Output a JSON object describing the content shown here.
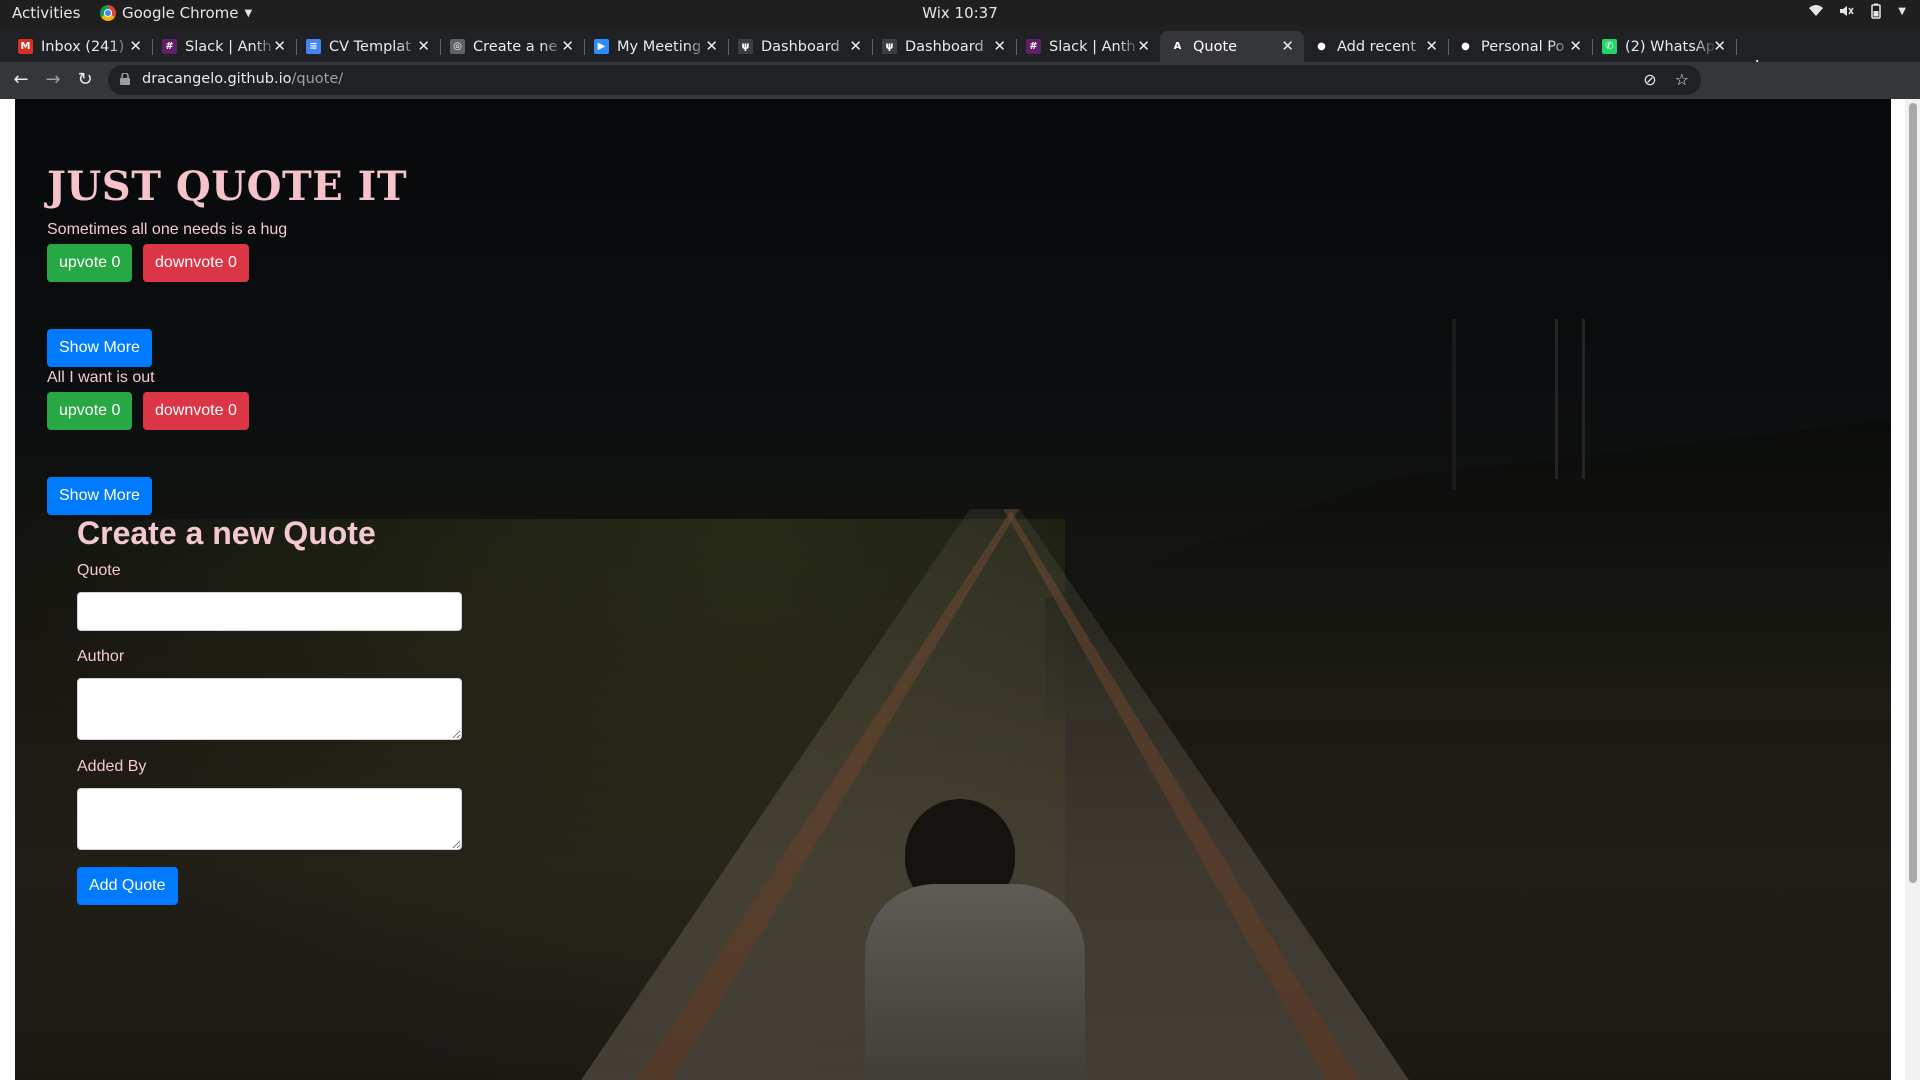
{
  "os_bar": {
    "activities": "Activities",
    "app_name": "Google Chrome",
    "clock": "Wix 10:37"
  },
  "browser": {
    "tabs": [
      {
        "title": "Inbox (241)",
        "icon": "gmail-icon",
        "color": "#d93025",
        "active": false
      },
      {
        "title": "Slack | Anth",
        "icon": "slack-icon",
        "color": "#611f69",
        "active": false
      },
      {
        "title": "CV Templat",
        "icon": "docs-icon",
        "color": "#4285f4",
        "active": false
      },
      {
        "title": "Create a ne",
        "icon": "globe-icon",
        "color": "#5f6368",
        "active": false
      },
      {
        "title": "My Meeting",
        "icon": "zoom-icon",
        "color": "#2d8cff",
        "active": false
      },
      {
        "title": "Dashboard",
        "icon": "palm-icon",
        "color": "#3c4043",
        "active": false
      },
      {
        "title": "Dashboard",
        "icon": "palm-icon",
        "color": "#3c4043",
        "active": false
      },
      {
        "title": "Slack | Anth",
        "icon": "slack-icon",
        "color": "#611f69",
        "active": false
      },
      {
        "title": "Quote",
        "icon": "angular-a-icon",
        "color": "#35363a",
        "active": true
      },
      {
        "title": "Add recent",
        "icon": "github-icon",
        "color": "#202124",
        "active": false
      },
      {
        "title": "Personal Po",
        "icon": "github-icon",
        "color": "#202124",
        "active": false
      },
      {
        "title": "(2) WhatsAp",
        "icon": "whatsapp-icon",
        "color": "#25d366",
        "active": false
      }
    ],
    "url_host": "dracangelo.github.io",
    "url_path": "/quote/"
  },
  "page": {
    "title": "JUST QUOTE IT",
    "quotes": [
      {
        "text": "Sometimes all one needs is a hug",
        "upvote_label": "upvote 0",
        "downvote_label": "downvote 0",
        "show_more_label": "Show More"
      },
      {
        "text": "All I want is out",
        "upvote_label": "upvote 0",
        "downvote_label": "downvote 0",
        "show_more_label": "Show More"
      }
    ],
    "form": {
      "title": "Create a new Quote",
      "quote_label": "Quote",
      "quote_value": "",
      "author_label": "Author",
      "author_value": "",
      "added_by_label": "Added By",
      "added_by_value": "",
      "submit_label": "Add Quote"
    }
  },
  "colors": {
    "upvote": "#28a745",
    "downvote": "#dc3545",
    "primary": "#007bff",
    "heading_pink": "#f7c3cb"
  }
}
